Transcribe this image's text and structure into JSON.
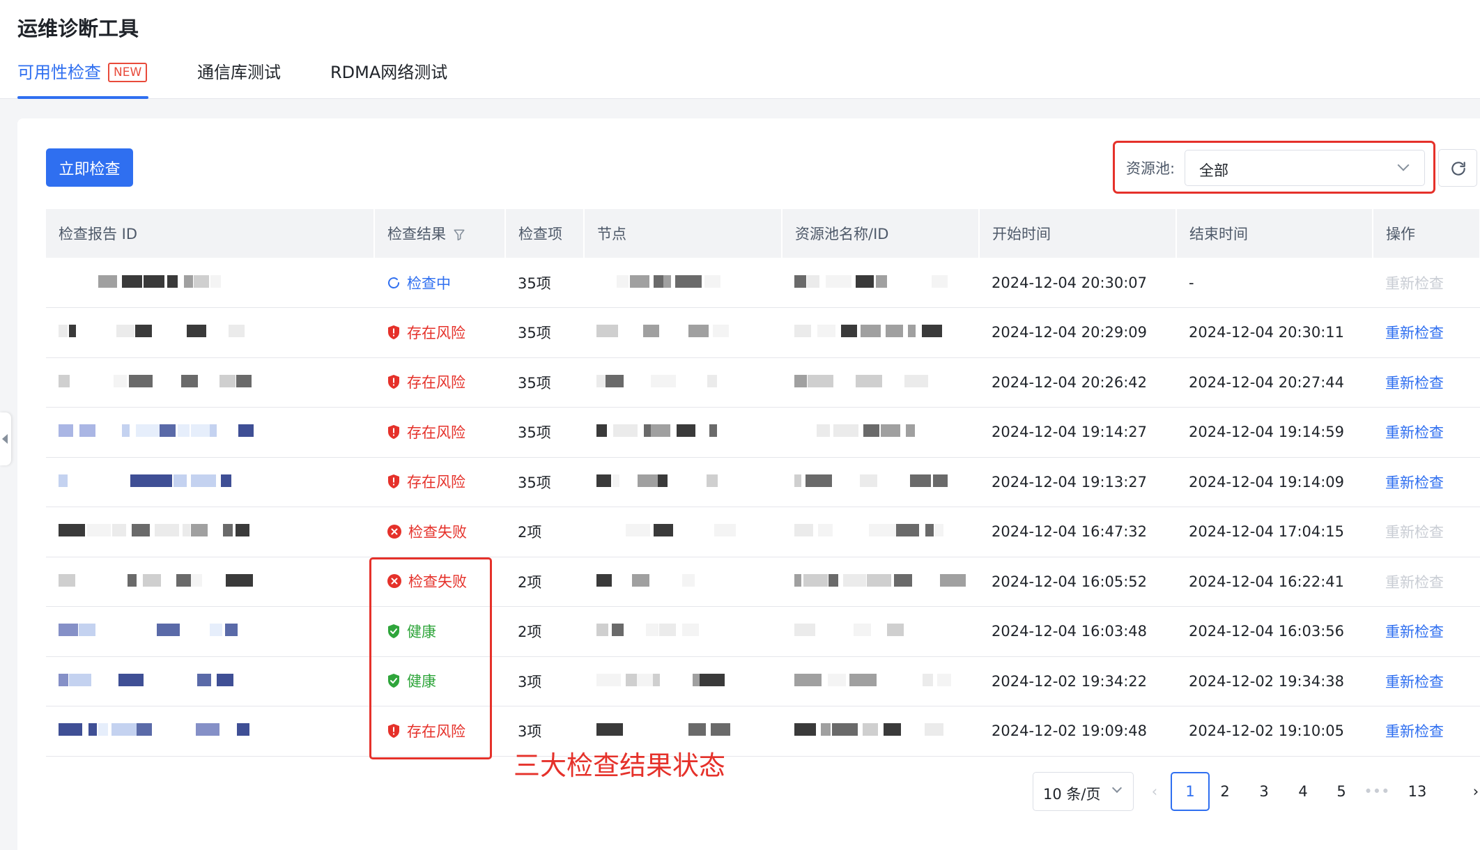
{
  "app": {
    "title": "运维诊断工具"
  },
  "tabs": [
    {
      "label": "可用性检查",
      "badge": "NEW",
      "active": true
    },
    {
      "label": "通信库测试",
      "active": false
    },
    {
      "label": "RDMA网络测试",
      "active": false
    }
  ],
  "toolbar": {
    "check_now_label": "立即检查",
    "pool_filter_label": "资源池:",
    "pool_filter_value": "全部",
    "refresh_icon": "refresh-icon"
  },
  "table": {
    "columns": [
      "检查报告 ID",
      "检查结果",
      "检查项",
      "节点",
      "资源池名称/ID",
      "开始时间",
      "结束时间",
      "操作"
    ],
    "rows": [
      {
        "status": "检查中",
        "status_type": "running",
        "items": "35项",
        "start": "2024-12-04 20:30:07",
        "end": "-",
        "action": "重新检查",
        "action_enabled": false
      },
      {
        "status": "存在风险",
        "status_type": "risk",
        "items": "35项",
        "start": "2024-12-04 20:29:09",
        "end": "2024-12-04 20:30:11",
        "action": "重新检查",
        "action_enabled": true
      },
      {
        "status": "存在风险",
        "status_type": "risk",
        "items": "35项",
        "start": "2024-12-04 20:26:42",
        "end": "2024-12-04 20:27:44",
        "action": "重新检查",
        "action_enabled": true
      },
      {
        "status": "存在风险",
        "status_type": "risk",
        "items": "35项",
        "start": "2024-12-04 19:14:27",
        "end": "2024-12-04 19:14:59",
        "action": "重新检查",
        "action_enabled": true
      },
      {
        "status": "存在风险",
        "status_type": "risk",
        "items": "35项",
        "start": "2024-12-04 19:13:27",
        "end": "2024-12-04 19:14:09",
        "action": "重新检查",
        "action_enabled": true
      },
      {
        "status": "检查失败",
        "status_type": "failed",
        "items": "2项",
        "start": "2024-12-04 16:47:32",
        "end": "2024-12-04 17:04:15",
        "action": "重新检查",
        "action_enabled": false
      },
      {
        "status": "检查失败",
        "status_type": "failed",
        "items": "2项",
        "start": "2024-12-04 16:05:52",
        "end": "2024-12-04 16:22:41",
        "action": "重新检查",
        "action_enabled": false
      },
      {
        "status": "健康",
        "status_type": "healthy",
        "items": "2项",
        "start": "2024-12-04 16:03:48",
        "end": "2024-12-04 16:03:56",
        "action": "重新检查",
        "action_enabled": true
      },
      {
        "status": "健康",
        "status_type": "healthy",
        "items": "3项",
        "start": "2024-12-02 19:34:22",
        "end": "2024-12-02 19:34:38",
        "action": "重新检查",
        "action_enabled": true
      },
      {
        "status": "存在风险",
        "status_type": "risk",
        "items": "3项",
        "start": "2024-12-02 19:09:48",
        "end": "2024-12-02 19:10:05",
        "action": "重新检查",
        "action_enabled": true
      }
    ]
  },
  "annotation": {
    "text": "三大检查结果状态"
  },
  "pagination": {
    "page_size_label": "10 条/页",
    "pages": [
      "1",
      "2",
      "3",
      "4",
      "5",
      "•••",
      "13"
    ],
    "current": "1"
  },
  "colors": {
    "primary": "#2f6ff0",
    "risk": "#e5312a",
    "healthy": "#2fa53b",
    "disabled": "#c9cdd4",
    "highlight": "#e5312a"
  }
}
